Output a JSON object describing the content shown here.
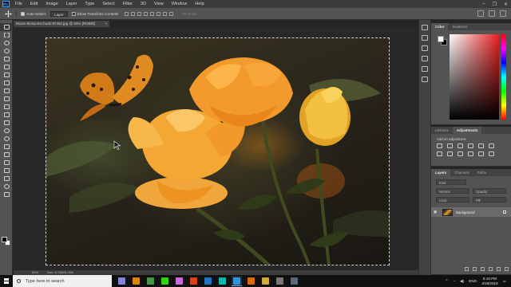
{
  "menubar": {
    "logo": "Ps",
    "items": [
      "File",
      "Edit",
      "Image",
      "Layer",
      "Type",
      "Select",
      "Filter",
      "3D",
      "View",
      "Window",
      "Help"
    ],
    "controls": [
      "–",
      "❐",
      "✕"
    ]
  },
  "options": {
    "auto_select_label": "Auto-Select:",
    "auto_select_value": "Layer",
    "transform_controls_label": "Show Transform Controls",
    "mode_3d_label": "3D Mode:"
  },
  "document": {
    "tab_title": "bloom-blossoms-buds-87452.jpg @ 50% (RGB/8)",
    "tab_close": "×",
    "zoom": "50%",
    "doc_size": "Doc: 6.74M/6.74M"
  },
  "color_panel": {
    "tabs": [
      "Color",
      "Swatches"
    ]
  },
  "adjustments_panel": {
    "tabs": [
      "Libraries",
      "Adjustments"
    ],
    "add_label": "Add an adjustment"
  },
  "layers_panel": {
    "tabs": [
      "Layers",
      "Channels",
      "Paths"
    ],
    "kind_filter": "Kind",
    "blend_mode": "Normal",
    "opacity_label": "Opacity:",
    "lock_label": "Lock:",
    "fill_label": "Fill:",
    "layer_name": "Background"
  },
  "taskbar": {
    "search_placeholder": "Type here to search",
    "tray_lang": "ENG",
    "time": "5:19 PM",
    "date": "4/19/2019",
    "apps": [
      {
        "name": "after-effects",
        "color": "#9999ff"
      },
      {
        "name": "illustrator",
        "color": "#ff9a00"
      },
      {
        "name": "chrome",
        "color": "#4caf50"
      },
      {
        "name": "dreamweaver",
        "color": "#35fa00"
      },
      {
        "name": "premiere",
        "color": "#ea77ff"
      },
      {
        "name": "animate",
        "color": "#ff4a19"
      },
      {
        "name": "edge",
        "color": "#1e88e5"
      },
      {
        "name": "media-encoder",
        "color": "#00d8c8"
      },
      {
        "name": "photoshop",
        "color": "#31a8ff"
      },
      {
        "name": "media-player",
        "color": "#ff7a00"
      },
      {
        "name": "file-explorer",
        "color": "#f3c536"
      },
      {
        "name": "thumbnail-1",
        "color": "#8a8a8a"
      },
      {
        "name": "thumbnail-2",
        "color": "#6a7a8a"
      }
    ]
  }
}
